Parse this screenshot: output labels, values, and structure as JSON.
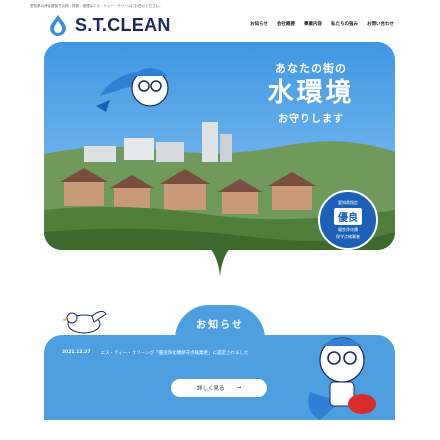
{
  "header": {
    "tagline": "愛知県の浄化槽保守点検・検査・管理はエス・ティー・クリーンにお任せください。",
    "logo_text": "S.T.CLEAN",
    "nav": [
      "お知らせ",
      "会社概要",
      "事業内容",
      "私たちの強み",
      "お問い合わせ"
    ]
  },
  "hero": {
    "copy_line1": "あなたの街の",
    "copy_line2": "水環境",
    "copy_line3": "お守りします",
    "badge": {
      "top": "愛知県指定",
      "main": "優良",
      "bottom1": "優良浄化槽",
      "bottom2": "保守点検業者"
    }
  },
  "news": {
    "title": "お知らせ",
    "items": [
      {
        "date": "2021.12.27",
        "text": "エス・ティー・クリーンが「優良浄化槽保守点検業者」に認定されました"
      }
    ],
    "more_label": "詳しく見る",
    "more_arrow": "→"
  },
  "colors": {
    "brand_blue": "#4e9fe0",
    "navy": "#1a2a5c"
  }
}
